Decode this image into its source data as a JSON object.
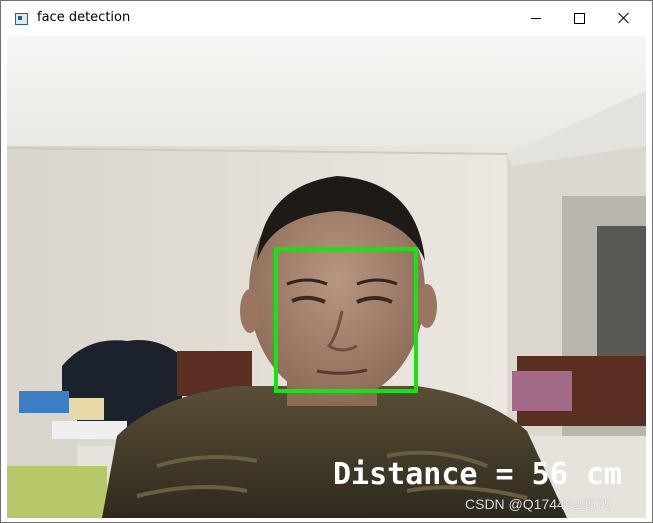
{
  "window": {
    "title": "face detection",
    "controls": {
      "minimize": "minimize-icon",
      "maximize": "maximize-icon",
      "close": "close-icon"
    }
  },
  "overlay": {
    "distance_text": "Distance = 56 cm",
    "box_color": "#10e610",
    "text_color": "#ffffff"
  },
  "watermark": {
    "text": "CSDN @Q1744828575"
  },
  "colors": {
    "wall": "#ece8e2",
    "ceiling": "#f4f4f2",
    "jacket": "#4a3f2a",
    "skin": "#a98870"
  }
}
